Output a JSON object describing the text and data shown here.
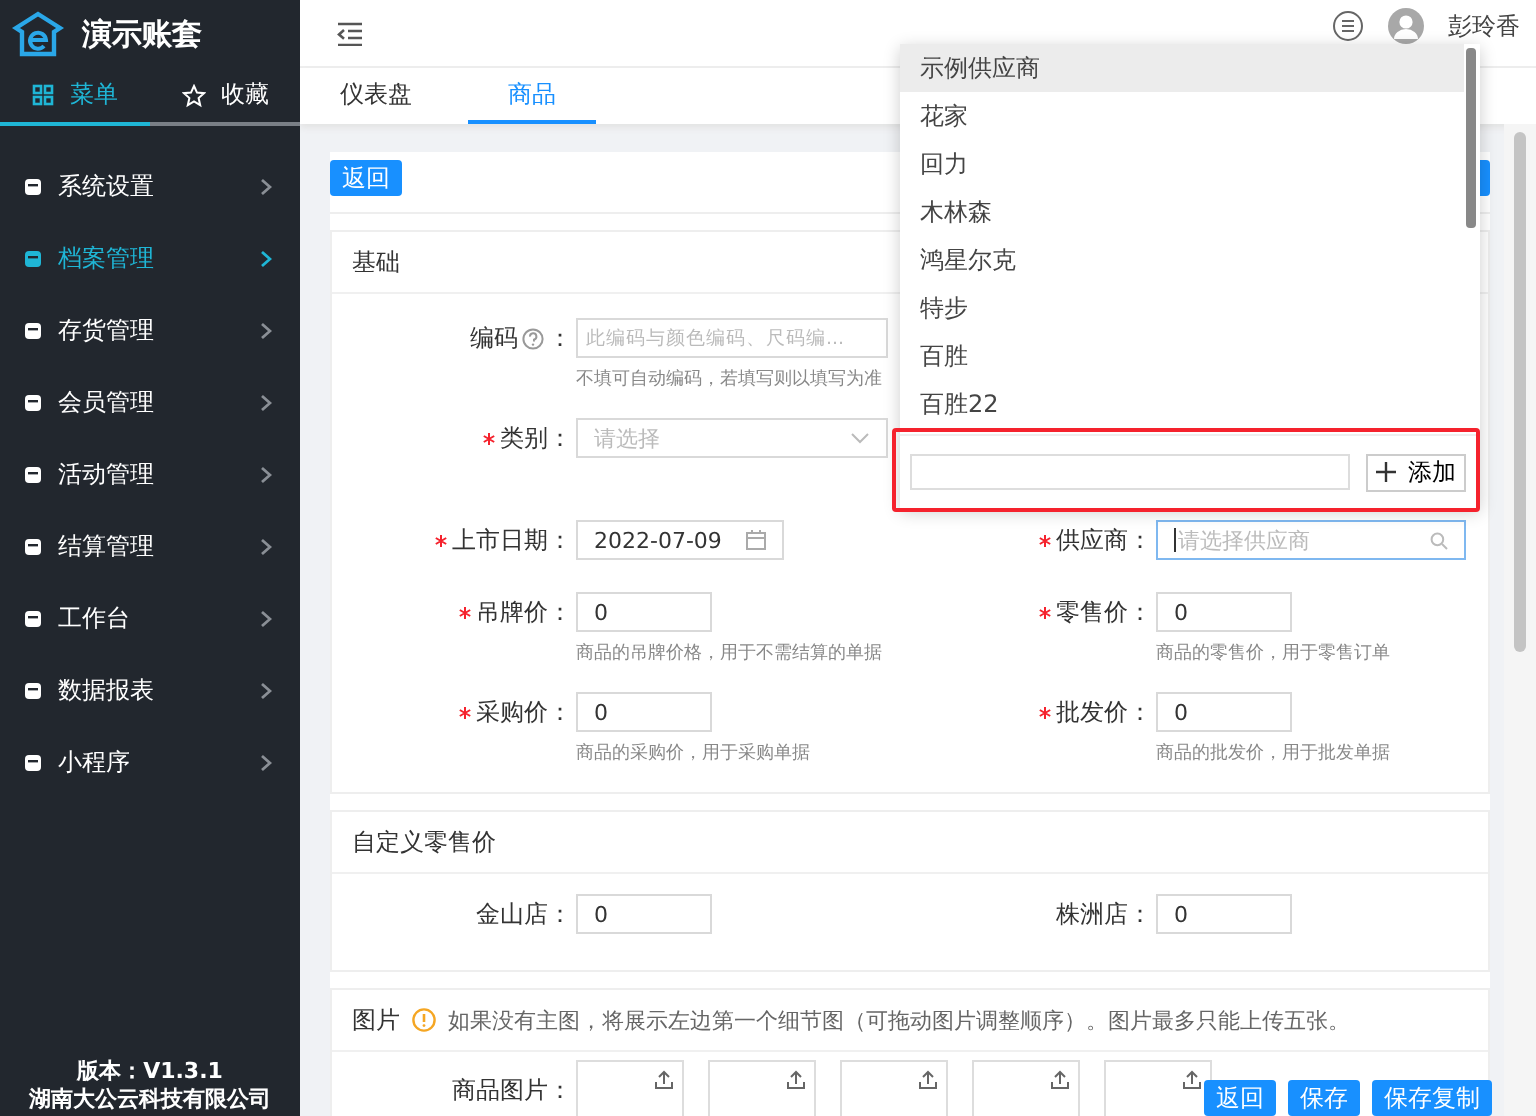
{
  "app": {
    "title": "演示账套",
    "version": "版本：V1.3.1",
    "company": "湖南大公云科技有限公司"
  },
  "sidebar_tabs": [
    {
      "label": "菜单",
      "selected": true
    },
    {
      "label": "收藏",
      "selected": false
    }
  ],
  "menu": [
    {
      "label": "系统设置",
      "selected": false
    },
    {
      "label": "档案管理",
      "selected": true
    },
    {
      "label": "存货管理",
      "selected": false
    },
    {
      "label": "会员管理",
      "selected": false
    },
    {
      "label": "活动管理",
      "selected": false
    },
    {
      "label": "结算管理",
      "selected": false
    },
    {
      "label": "工作台",
      "selected": false
    },
    {
      "label": "数据报表",
      "selected": false
    },
    {
      "label": "小程序",
      "selected": false
    }
  ],
  "user": {
    "name": "彭玲香"
  },
  "tabs": [
    {
      "label": "仪表盘",
      "selected": false
    },
    {
      "label": "商品",
      "selected": true
    }
  ],
  "back_button": "返回",
  "basic": {
    "title": "基础",
    "rows": [
      [
        {
          "kind": "text",
          "label": "编码",
          "help": true,
          "colon": "：",
          "required": false,
          "placeholder": "此编码与颜色编码、尺码编...",
          "hint": "不填可自动编码，若填写则以填写为准"
        }
      ],
      [
        {
          "kind": "select",
          "label": "类别：",
          "required": true,
          "placeholder": "请选择"
        }
      ],
      [
        {
          "kind": "date",
          "label": "上市日期：",
          "required": true,
          "value": "2022-07-09"
        },
        {
          "kind": "search",
          "label": "供应商：",
          "required": true,
          "placeholder": "请选择供应商",
          "focused": true
        }
      ],
      [
        {
          "kind": "price",
          "label": "吊牌价：",
          "required": true,
          "value": "0",
          "hint": "商品的吊牌价格，用于不需结算的单据"
        },
        {
          "kind": "price",
          "label": "零售价：",
          "required": true,
          "value": "0",
          "hint": "商品的零售价，用于零售订单"
        }
      ],
      [
        {
          "kind": "price",
          "label": "采购价：",
          "required": true,
          "value": "0",
          "hint": "商品的采购价，用于采购单据"
        },
        {
          "kind": "price",
          "label": "批发价：",
          "required": true,
          "value": "0",
          "hint": "商品的批发价，用于批发单据"
        }
      ]
    ]
  },
  "custom_price": {
    "title": "自定义零售价",
    "fields": [
      {
        "label": "金山店：",
        "value": "0"
      },
      {
        "label": "株洲店：",
        "value": "0"
      }
    ]
  },
  "pictures": {
    "title": "图片",
    "note": "如果没有主图，将展示左边第一个细节图（可拖动图片调整顺序）。图片最多只能上传五张。",
    "label": "商品图片："
  },
  "footer_buttons": [
    "返回",
    "保存",
    "保存复制"
  ],
  "supplier_dropdown": {
    "options": [
      {
        "label": "示例供应商",
        "selected": true
      },
      {
        "label": "花家",
        "selected": false
      },
      {
        "label": "回力",
        "selected": false
      },
      {
        "label": "木林森",
        "selected": false
      },
      {
        "label": "鸿星尔克",
        "selected": false
      },
      {
        "label": "特步",
        "selected": false
      },
      {
        "label": "百胜",
        "selected": false
      },
      {
        "label": "百胜22",
        "selected": false
      }
    ],
    "add_button": "添加",
    "highlighted": true
  }
}
